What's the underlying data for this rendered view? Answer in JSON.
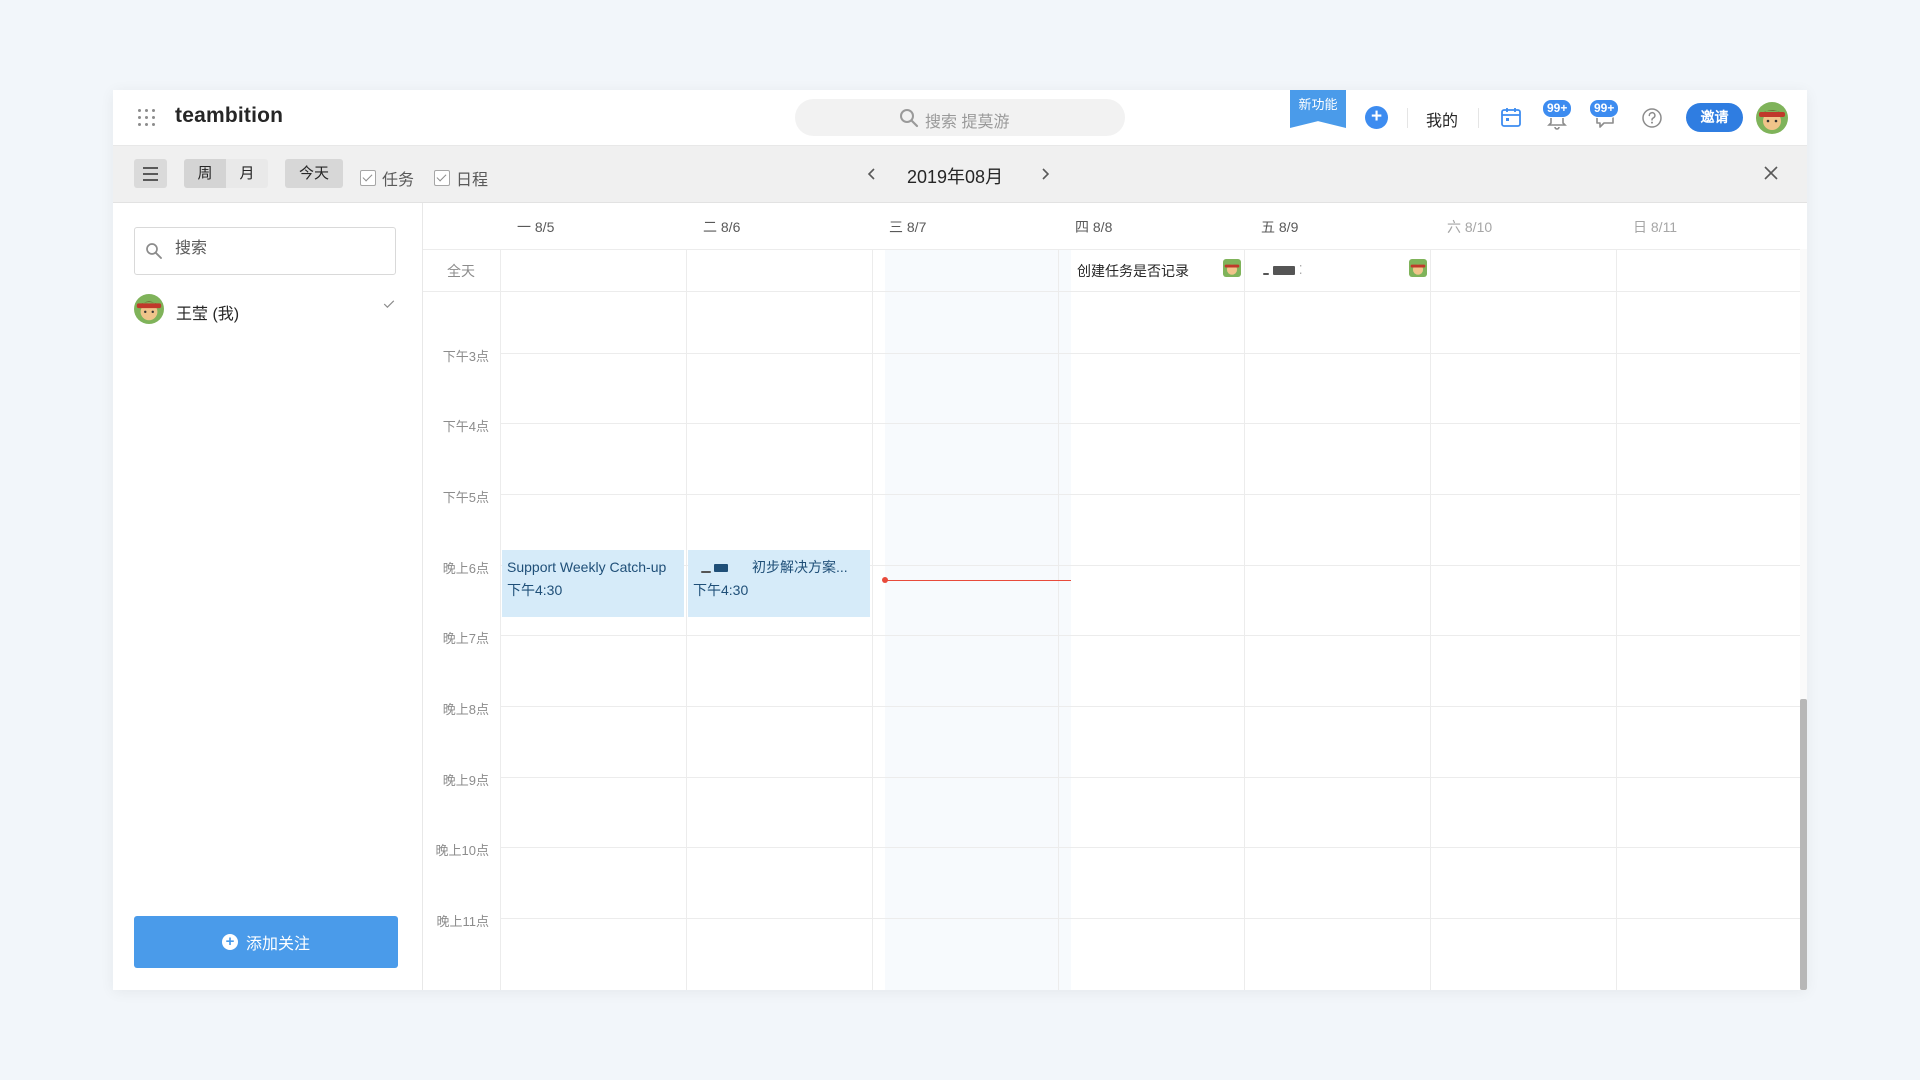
{
  "app": {
    "brand": "teambition"
  },
  "topbar": {
    "search_placeholder": "搜索 提莫游",
    "new_feature_label": "新功能",
    "add_symbol": "+",
    "mine_label": "我的",
    "notifications_badge": "99+",
    "messages_badge": "99+",
    "invite_label": "邀请"
  },
  "toolbar": {
    "view_week": "周",
    "view_month": "月",
    "active_view": "周",
    "today_label": "今天",
    "filter_tasks": "任务",
    "filter_schedule": "日程",
    "month_title": "2019年08月"
  },
  "sidebar": {
    "search_placeholder": "搜索",
    "members": [
      {
        "name": "王莹 (我)",
        "checked": true
      }
    ],
    "add_follow_label": "添加关注"
  },
  "calendar": {
    "allday_label": "全天",
    "days": [
      {
        "label": "一 8/5",
        "weekend": false
      },
      {
        "label": "二 8/6",
        "weekend": false
      },
      {
        "label": "三 8/7",
        "weekend": false,
        "today": true
      },
      {
        "label": "四 8/8",
        "weekend": false
      },
      {
        "label": "五 8/9",
        "weekend": false
      },
      {
        "label": "六 8/10",
        "weekend": true
      },
      {
        "label": "日 8/11",
        "weekend": true
      }
    ],
    "hours": [
      "下午3点",
      "下午4点",
      "下午5点",
      "晚上6点",
      "晚上7点",
      "晚上8点",
      "晚上9点",
      "晚上10点",
      "晚上11点"
    ],
    "allday_events": [
      {
        "day": 3,
        "title": "创建任务是否记录"
      },
      {
        "day": 4,
        "title": ""
      }
    ],
    "timed_events": [
      {
        "day": 0,
        "title": "Support Weekly Catch-up",
        "time": "下午4:30"
      },
      {
        "day": 1,
        "title": "初步解决方案...",
        "time": "下午4:30"
      }
    ]
  },
  "colors": {
    "accent": "#4a9bea",
    "primary_button": "#2f7de1",
    "event_bg": "#d6ebf9",
    "now_line": "#e84a3b"
  }
}
